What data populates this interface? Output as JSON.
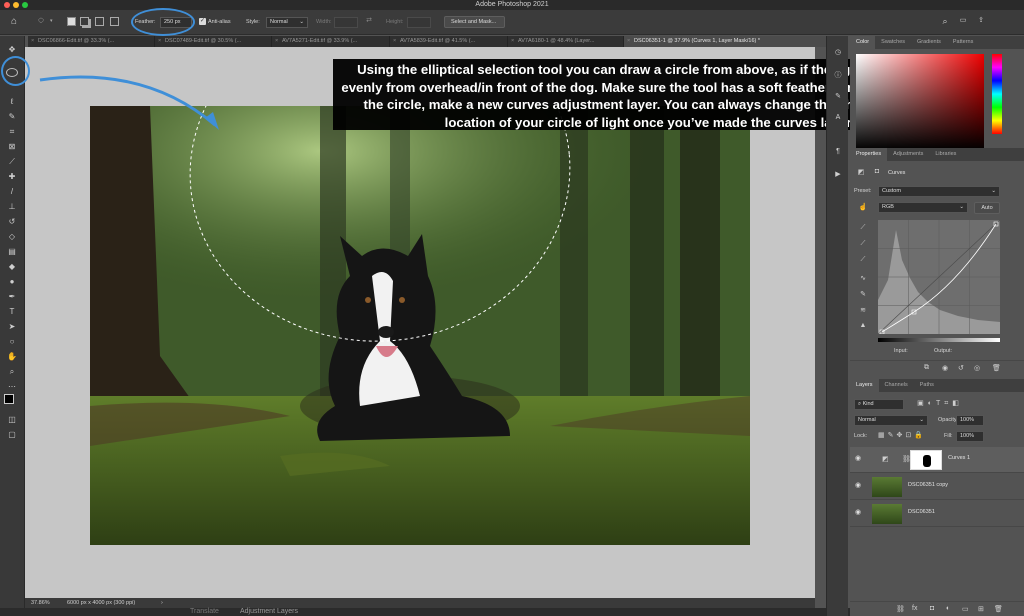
{
  "app_title": "Adobe Photoshop 2021",
  "options": {
    "feather_label": "Feather:",
    "feather_value": "250 px",
    "anti_alias_label": "Anti-alias",
    "style_label": "Style:",
    "style_value": "Normal",
    "width_label": "Width:",
    "height_label": "Height:",
    "select_mask_label": "Select and Mask..."
  },
  "tabs": [
    {
      "label": "DSC06866-Edit.tif @ 33.3% (..."
    },
    {
      "label": "DSC07489-Edit.tif @ 30.5% (..."
    },
    {
      "label": "AV7A5271-Edit.tif @ 33.9% (..."
    },
    {
      "label": "AV7A5839-Edit.tif @ 41.5% (..."
    },
    {
      "label": "AV7A6180-1 @ 48.4% (Layer..."
    },
    {
      "label": "DSC06351-1 @ 37.9% (Curves 1, Layer Mask/16) *"
    }
  ],
  "caption": "Using the elliptical selection tool you can draw a circle from above, as if the light was shining evenly from overhead/in front of the dog. Make sure the tool has a soft feather. Once you’ve drawn the circle, make a new curves adjustment layer. You can always change the shape, size and location of your circle of light once you’ve made the curves layer.",
  "status": {
    "zoom": "37.86%",
    "doc_info": "6000 px x 4000 px (300 ppi)"
  },
  "bottom_text": "Translate",
  "bottom_text2": "Adjustment Layers",
  "color_panel": {
    "tabs": [
      "Color",
      "Swatches",
      "Gradients",
      "Patterns"
    ]
  },
  "properties_panel": {
    "tabs": [
      "Properties",
      "Adjustments",
      "Libraries"
    ],
    "title": "Curves",
    "preset_label": "Preset:",
    "preset_value": "Custom",
    "channel_value": "RGB",
    "auto_label": "Auto",
    "input_label": "Input:",
    "output_label": "Output:"
  },
  "layers_panel": {
    "tabs": [
      "Layers",
      "Channels",
      "Paths"
    ],
    "filter_value": "Kind",
    "blend_mode": "Normal",
    "opacity_label": "Opacity:",
    "opacity_value": "100%",
    "lock_label": "Lock:",
    "fill_label": "Fill:",
    "fill_value": "100%",
    "layers": [
      {
        "name": "Curves 1"
      },
      {
        "name": "DSC06351 copy"
      },
      {
        "name": "DSC06351"
      }
    ]
  },
  "colors": {
    "annotation": "#3f8fd8",
    "foreground": "#000000",
    "background": "#ffffff"
  }
}
